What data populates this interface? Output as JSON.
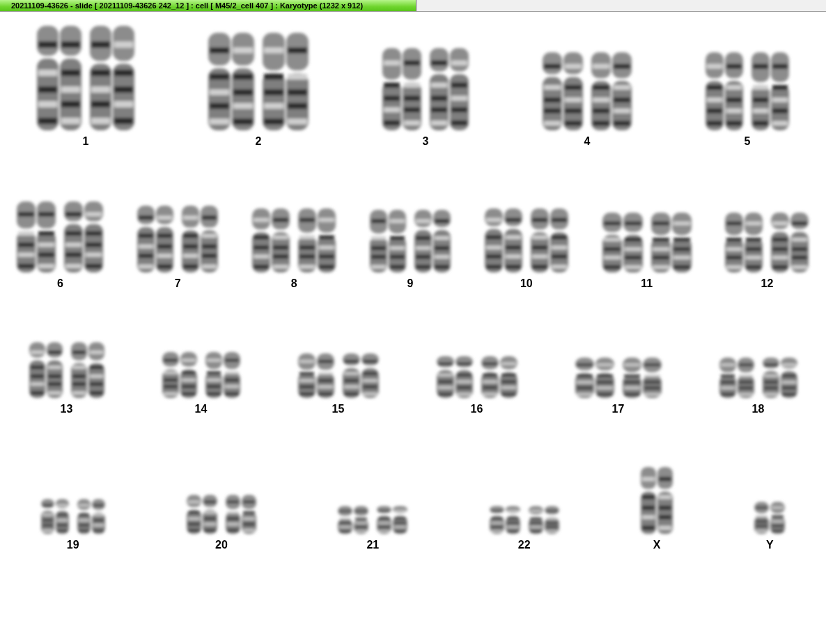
{
  "title_tab": {
    "text": "20211109-43626 - slide [ 20211109-43626 242_12 ] : cell [ M45/2_cell 407 ] : Karyotype  (1232 x 912)",
    "selected": true
  },
  "rows": [
    {
      "items": [
        {
          "label": "1",
          "kind": "pair"
        },
        {
          "label": "2",
          "kind": "pair"
        },
        {
          "label": "3",
          "kind": "pair"
        },
        {
          "label": "4",
          "kind": "pair"
        },
        {
          "label": "5",
          "kind": "pair"
        }
      ]
    },
    {
      "items": [
        {
          "label": "6",
          "kind": "pair"
        },
        {
          "label": "7",
          "kind": "pair"
        },
        {
          "label": "8",
          "kind": "pair"
        },
        {
          "label": "9",
          "kind": "pair"
        },
        {
          "label": "10",
          "kind": "pair"
        },
        {
          "label": "11",
          "kind": "pair"
        },
        {
          "label": "12",
          "kind": "pair"
        }
      ]
    },
    {
      "items": [
        {
          "label": "13",
          "kind": "pair"
        },
        {
          "label": "14",
          "kind": "pair"
        },
        {
          "label": "15",
          "kind": "pair"
        },
        {
          "label": "16",
          "kind": "pair"
        },
        {
          "label": "17",
          "kind": "pair"
        },
        {
          "label": "18",
          "kind": "pair"
        }
      ]
    },
    {
      "items": [
        {
          "label": "19",
          "kind": "pair"
        },
        {
          "label": "20",
          "kind": "pair"
        },
        {
          "label": "21",
          "kind": "pair"
        },
        {
          "label": "22",
          "kind": "pair"
        },
        {
          "label": "X",
          "kind": "single"
        },
        {
          "label": "Y",
          "kind": "single"
        }
      ]
    }
  ]
}
